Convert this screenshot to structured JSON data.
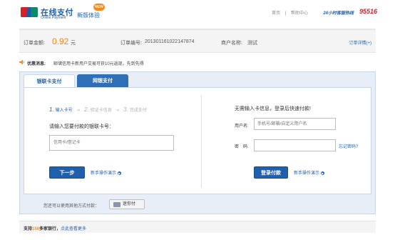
{
  "header": {
    "logo_mark_text": "UnionPay 银联",
    "logo_cn": "在线支付",
    "logo_en": "Online Payment",
    "edition": "新版体验",
    "new_badge": "NEW",
    "links": [
      "首页",
      "帮助中心"
    ],
    "hotline_label": "24小时客服热线",
    "hotline_number": "95516"
  },
  "order": {
    "amount_label": "订单金额:",
    "amount": "0.92",
    "currency": "元",
    "order_no_label": "订单编号:",
    "order_no": "20130116102214787​4",
    "merchant_label": "商户名称:",
    "merchant": "测试",
    "details_link": "订单详情(+)"
  },
  "promo": {
    "icon": "speaker-icon",
    "title": "优惠消息:",
    "text": "邮储信用卡新用户交易可获10元返现，先到先得"
  },
  "tabs": [
    {
      "label": "银联卡支付",
      "active": true
    },
    {
      "label": "网银支付",
      "active": false
    }
  ],
  "left": {
    "steps": [
      {
        "num": "1.",
        "label": "输入卡号",
        "active": true
      },
      {
        "num": "2.",
        "label": "验证卡信息",
        "active": false
      },
      {
        "num": "3.",
        "label": "完成支付",
        "active": false
      }
    ],
    "prompt": "请输入您要付款的银联卡号：",
    "card_placeholder": "信用卡/借记卡",
    "next_button": "下一步",
    "guide_link": "新手操作演示"
  },
  "right": {
    "title": "无需输入卡信息，登录后快速付款!",
    "username_label": "用户名:",
    "username_placeholder": "手机号/邮箱/自定义用户名",
    "password_label": "密　码:",
    "forgot_link": "忘记密码?",
    "login_button": "登录付款",
    "guide_link": "新手操作演示"
  },
  "other": {
    "text": "您还可以使用其他方式付款：",
    "button": "迷你付"
  },
  "footer": {
    "prefix": "支持",
    "count": "150",
    "suffix": "多家银行，",
    "more_link": "点此查看更多"
  },
  "colors": {
    "brand_blue": "#1f5fad",
    "accent_orange": "#f18a1c",
    "hotline_red": "#d81e27",
    "panel_bg": "#e7eef7"
  }
}
